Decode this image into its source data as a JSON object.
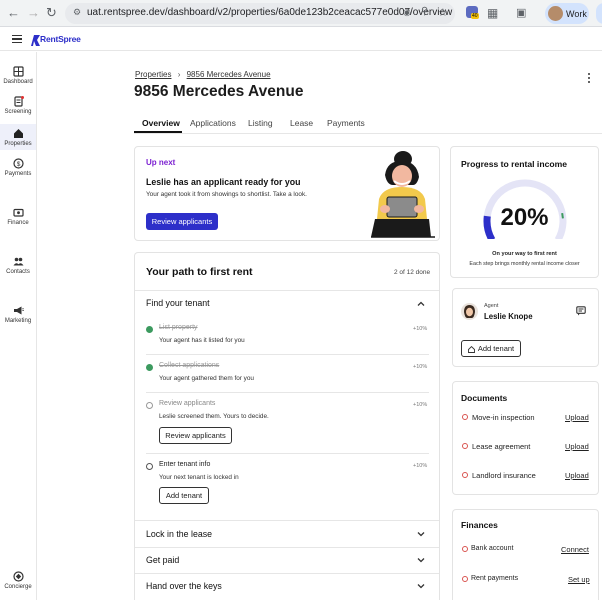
{
  "browser": {
    "url": "uat.rentspree.dev/dashboard/v2/properties/6a0de123b2ceacac577e0d07/overview",
    "profile": "Work",
    "extension_badge": "40"
  },
  "app": {
    "brand": "RentSpree"
  },
  "sidebar": {
    "items": [
      {
        "label": "Dashboard"
      },
      {
        "label": "Screening"
      },
      {
        "label": "Properties"
      },
      {
        "label": "Payments"
      },
      {
        "label": "Finance"
      },
      {
        "label": "Contacts"
      },
      {
        "label": "Marketing"
      },
      {
        "label": "Concierge"
      }
    ]
  },
  "breadcrumb": {
    "root": "Properties",
    "current": "9856 Mercedes Avenue"
  },
  "page_title": "9856 Mercedes Avenue",
  "tabs": [
    "Overview",
    "Applications",
    "Listing",
    "Lease",
    "Payments"
  ],
  "up_next": {
    "tag": "Up next",
    "headline": "Leslie has an applicant ready for you",
    "body": "Your agent took it from showings to shortlist. Take a look.",
    "button": "Review applicants"
  },
  "path": {
    "title": "Your path to first rent",
    "progress": "2 of 12 done",
    "section_title": "Find your tenant",
    "steps": [
      {
        "label": "List property",
        "desc": "Your agent has it listed for you",
        "pct": "+10%"
      },
      {
        "label": "Collect applications",
        "desc": "Your agent gathered them for you",
        "pct": "+10%"
      },
      {
        "label": "Review applicants",
        "desc": "Leslie screened them. Yours to decide.",
        "pct": "+10%",
        "button": "Review applicants"
      },
      {
        "label": "Enter tenant info",
        "desc": "Your next tenant is locked in",
        "pct": "+10%",
        "button": "Add tenant"
      }
    ],
    "collapsed": [
      "Lock in the lease",
      "Get paid",
      "Hand over the keys"
    ]
  },
  "rental_progress": {
    "title": "Progress to rental income",
    "value": "20%",
    "fraction": 0.2,
    "caption": "On your way to first rent",
    "subcaption": "Each step brings monthly rental income closer"
  },
  "agent": {
    "role": "Agent",
    "name": "Leslie Knope",
    "button": "Add tenant"
  },
  "documents": {
    "title": "Documents",
    "items": [
      {
        "label": "Move-in inspection",
        "action": "Upload"
      },
      {
        "label": "Lease agreement",
        "action": "Upload"
      },
      {
        "label": "Landlord insurance",
        "action": "Upload"
      }
    ]
  },
  "finances": {
    "title": "Finances",
    "items": [
      {
        "label": "Bank account",
        "action": "Connect"
      },
      {
        "label": "Rent payments",
        "action": "Set up"
      }
    ]
  },
  "colors": {
    "brand": "#2d2fc9",
    "accent": "#7b1fd1",
    "success": "#3c9a5f",
    "warning": "#d9534f"
  }
}
